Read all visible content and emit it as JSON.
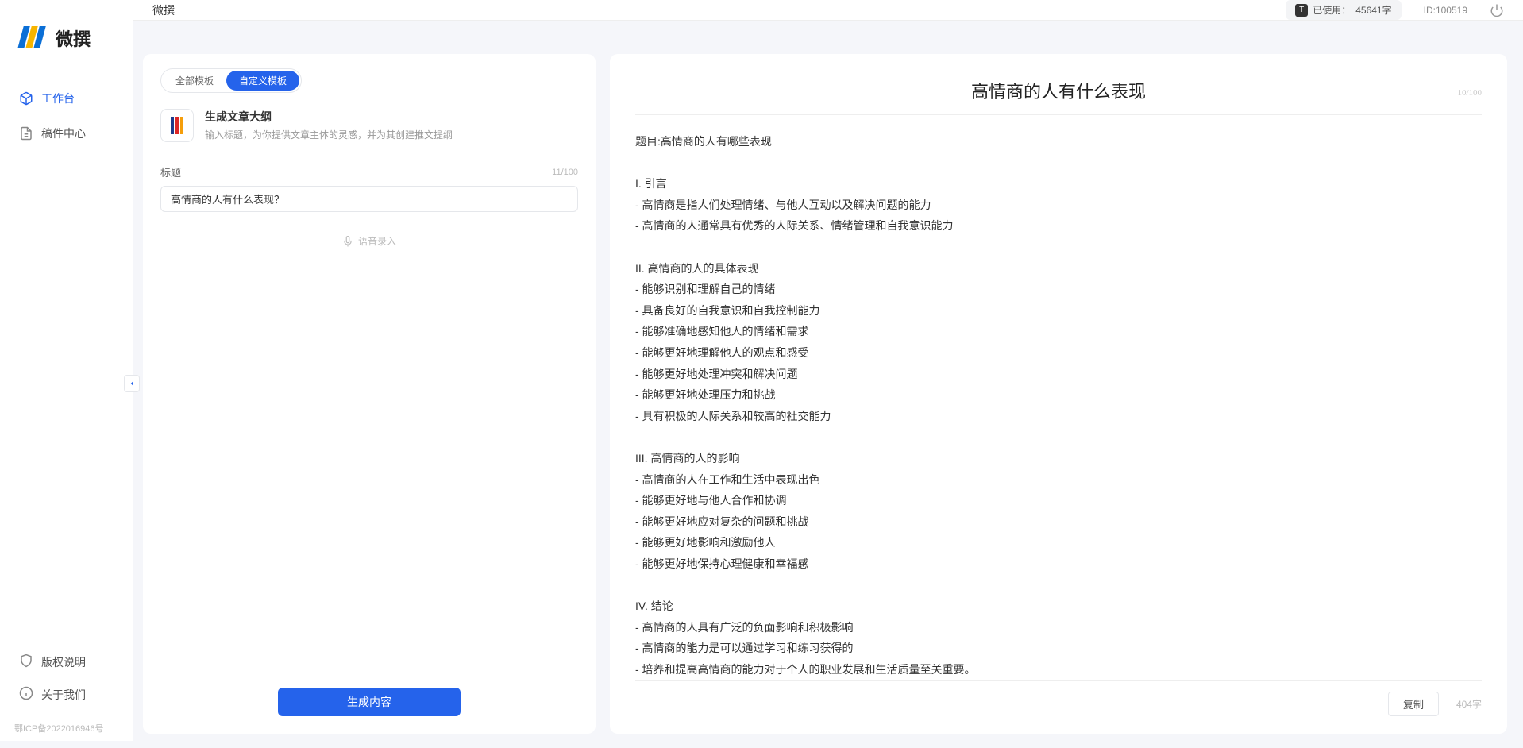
{
  "app": {
    "brand": "微撰",
    "page_title": "微撰"
  },
  "sidebar": {
    "items": [
      {
        "label": "工作台"
      },
      {
        "label": "稿件中心"
      }
    ],
    "footer": [
      {
        "label": "版权说明"
      },
      {
        "label": "关于我们"
      }
    ],
    "icp": "鄂ICP备2022016946号"
  },
  "topbar": {
    "usage_prefix": "已使用：",
    "usage_value": "45641字",
    "usage_badge": "T",
    "user_id": "ID:100519"
  },
  "left_panel": {
    "tabs": [
      {
        "label": "全部模板"
      },
      {
        "label": "自定义模板"
      }
    ],
    "template": {
      "title": "生成文章大纲",
      "desc": "输入标题，为你提供文章主体的灵感，并为其创建推文提纲"
    },
    "field": {
      "label": "标题",
      "counter": "11/100",
      "value": "高情商的人有什么表现？"
    },
    "voice_hint": "语音录入",
    "generate_btn": "生成内容"
  },
  "right_panel": {
    "title": "高情商的人有什么表现",
    "title_counter": "10/100",
    "body": "题目:高情商的人有哪些表现\n\nI. 引言\n- 高情商是指人们处理情绪、与他人互动以及解决问题的能力\n- 高情商的人通常具有优秀的人际关系、情绪管理和自我意识能力\n\nII. 高情商的人的具体表现\n- 能够识别和理解自己的情绪\n- 具备良好的自我意识和自我控制能力\n- 能够准确地感知他人的情绪和需求\n- 能够更好地理解他人的观点和感受\n- 能够更好地处理冲突和解决问题\n- 能够更好地处理压力和挑战\n- 具有积极的人际关系和较高的社交能力\n\nIII. 高情商的人的影响\n- 高情商的人在工作和生活中表现出色\n- 能够更好地与他人合作和协调\n- 能够更好地应对复杂的问题和挑战\n- 能够更好地影响和激励他人\n- 能够更好地保持心理健康和幸福感\n\nIV. 结论\n- 高情商的人具有广泛的负面影响和积极影响\n- 高情商的能力是可以通过学习和练习获得的\n- 培养和提高高情商的能力对于个人的职业发展和生活质量至关重要。",
    "copy_btn": "复制",
    "word_count": "404字"
  }
}
